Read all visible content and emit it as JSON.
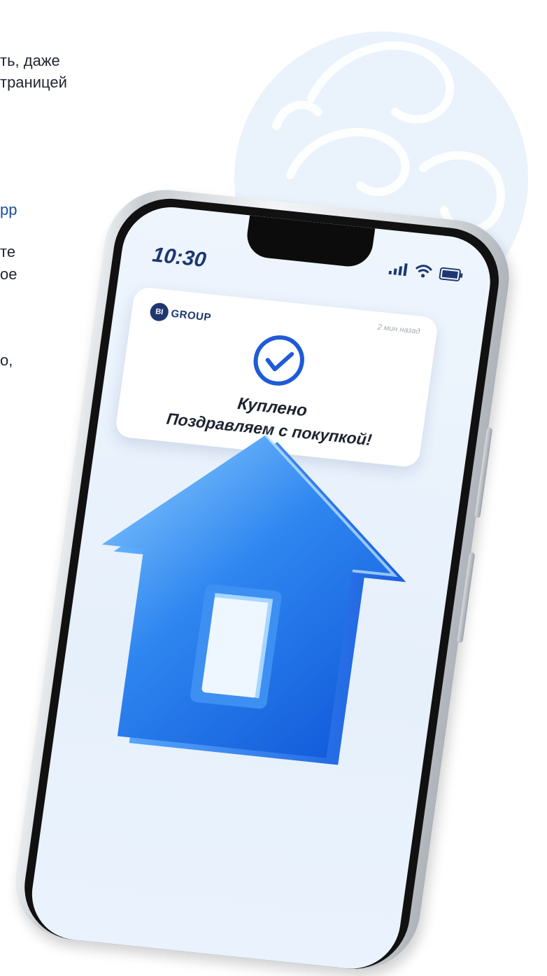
{
  "left_text": {
    "line1": "ть, даже",
    "line2": "траницей",
    "line3": "pp",
    "line4": "те",
    "line5": "ое",
    "line6": "о,"
  },
  "phone": {
    "status_time": "10:30",
    "notification": {
      "brand": "GROUP",
      "brand_badge": "BI",
      "time_ago": "2 мин назад",
      "title": "Куплено",
      "subtitle": "Поздравляем с покупкой!"
    }
  },
  "colors": {
    "accent": "#1d3770",
    "link": "#1b4fa0",
    "check": "#1f5bd6",
    "house": "#2f86f0"
  },
  "icons": [
    "signal-icon",
    "wifi-icon",
    "battery-icon",
    "check-circle-icon",
    "house-icon",
    "ornament-icon"
  ]
}
